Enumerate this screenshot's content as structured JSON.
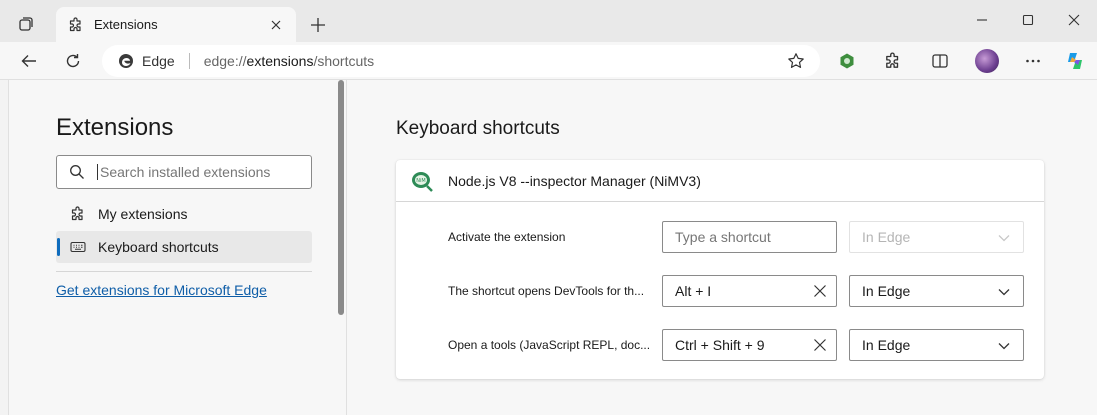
{
  "browser": {
    "tab": {
      "title": "Extensions"
    },
    "address": {
      "site_label": "Edge",
      "url_prefix": "edge://",
      "url_host": "extensions",
      "url_path": "/shortcuts"
    }
  },
  "sidebar": {
    "title": "Extensions",
    "search": {
      "placeholder": "Search installed extensions"
    },
    "items": [
      {
        "label": "My extensions",
        "icon": "puzzle-icon",
        "active": false
      },
      {
        "label": "Keyboard shortcuts",
        "icon": "keyboard-icon",
        "active": true
      }
    ],
    "get_link": "Get extensions for Microsoft Edge"
  },
  "main": {
    "title": "Keyboard shortcuts",
    "extension": {
      "name": "Node.js V8 --inspector Manager (NiMV3)",
      "icon": "nim-logo-icon"
    },
    "shortcuts": [
      {
        "command": "Activate the extension",
        "shortcut": "",
        "placeholder": "Type a shortcut",
        "scope": "In Edge",
        "scope_disabled": true
      },
      {
        "command": "The shortcut opens DevTools for th...",
        "shortcut": "Alt + I",
        "placeholder": "",
        "scope": "In Edge",
        "scope_disabled": false
      },
      {
        "command": "Open a tools (JavaScript REPL, doc...",
        "shortcut": "Ctrl + Shift + 9",
        "placeholder": "",
        "scope": "In Edge",
        "scope_disabled": false
      }
    ]
  },
  "colors": {
    "accent": "#0f6cbd",
    "link": "#0f5ea8"
  }
}
